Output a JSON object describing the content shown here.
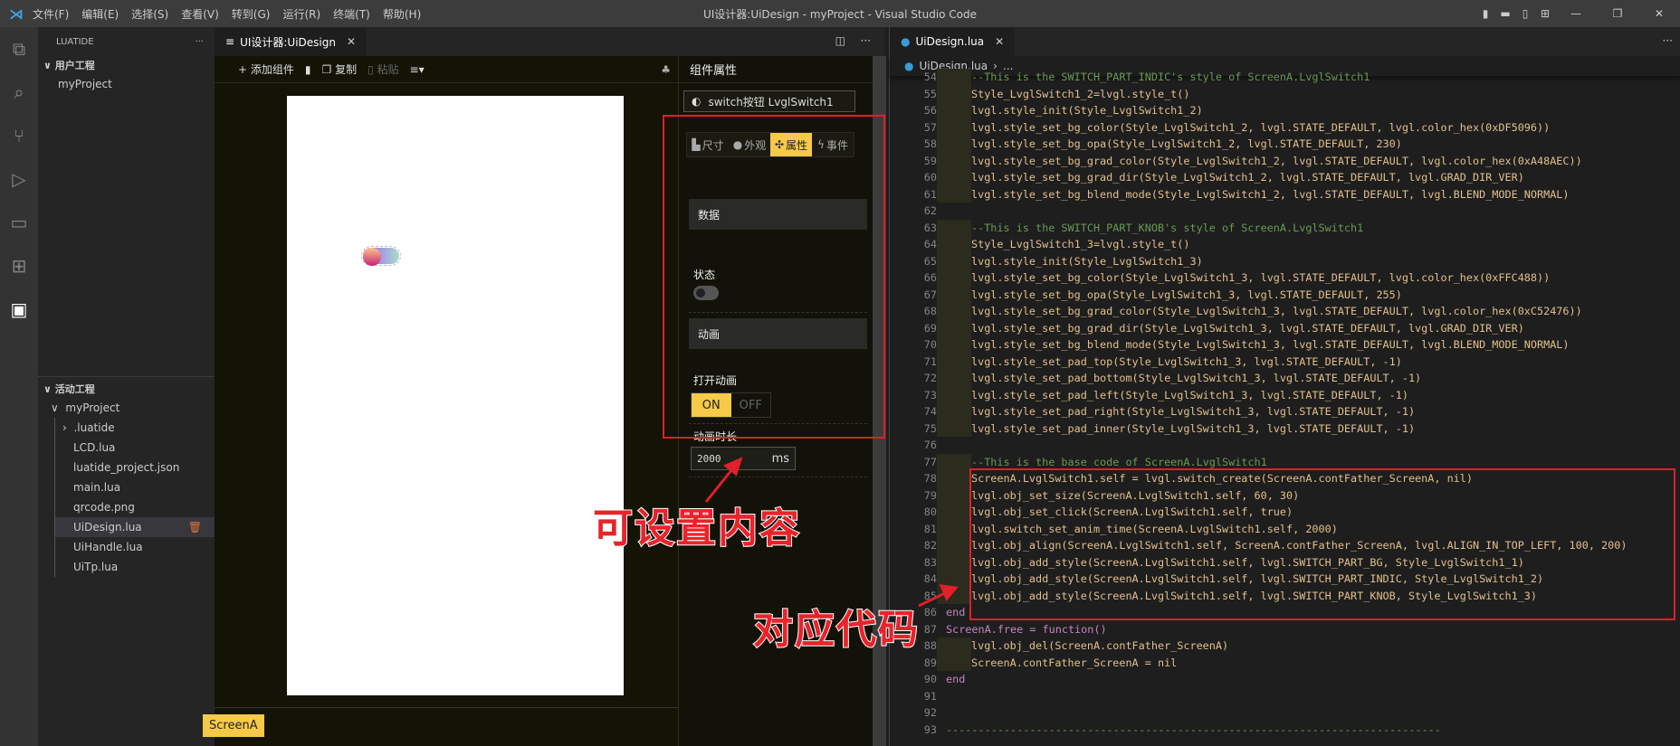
{
  "titlebar": {
    "menu": [
      "文件(F)",
      "编辑(E)",
      "选择(S)",
      "查看(V)",
      "转到(G)",
      "运行(R)",
      "终端(T)",
      "帮助(H)"
    ],
    "title": "UI设计器:UiDesign - myProject - Visual Studio Code"
  },
  "sidebar": {
    "header": "LUATIDE",
    "more": "···",
    "user_section": "用户工程",
    "user_items": [
      "myProject"
    ],
    "active_section": "活动工程",
    "project": "myProject",
    "files": [
      ".luatide",
      "LCD.lua",
      "luatide_project.json",
      "main.lua",
      "qrcode.png",
      "UiDesign.lua",
      "UiHandle.lua",
      "UiTp.lua"
    ],
    "selected_file": "UiDesign.lua"
  },
  "designer": {
    "tab": "UI设计器:UiDesign",
    "toolbar": {
      "add": "+ 添加组件",
      "copy": "复制",
      "paste": "粘贴"
    },
    "screen_tab": "ScreenA",
    "props": {
      "header": "组件属性",
      "selected": "switch按钮 LvglSwitch1",
      "tabs": [
        "尺寸",
        "外观",
        "属性",
        "事件"
      ],
      "active_tab": "属性",
      "group_data": "数据",
      "state_label": "状态",
      "state_value": false,
      "group_anim": "动画",
      "anim_open_label": "打开动画",
      "on": "ON",
      "off": "OFF",
      "anim_time_label": "动画时长",
      "anim_time": "2000",
      "anim_unit": "ms"
    }
  },
  "editor": {
    "tab": "UiDesign.lua",
    "breadcrumb": "UiDesign.lua",
    "breadcrumb_more": "...",
    "lines": [
      {
        "n": "54",
        "ind": 1,
        "text": "--This is the SWITCH_PART_INDIC's style of ScreenA.LvglSwitch1"
      },
      {
        "n": "55",
        "ind": 1,
        "text": "Style_LvglSwitch1_2=lvgl.style_t()"
      },
      {
        "n": "56",
        "ind": 1,
        "text": "lvgl.style_init(Style_LvglSwitch1_2)"
      },
      {
        "n": "57",
        "ind": 1,
        "text": "lvgl.style_set_bg_color(Style_LvglSwitch1_2, lvgl.STATE_DEFAULT, lvgl.color_hex(0xDF5096))"
      },
      {
        "n": "58",
        "ind": 1,
        "text": "lvgl.style_set_bg_opa(Style_LvglSwitch1_2, lvgl.STATE_DEFAULT, 230)"
      },
      {
        "n": "59",
        "ind": 1,
        "text": "lvgl.style_set_bg_grad_color(Style_LvglSwitch1_2, lvgl.STATE_DEFAULT, lvgl.color_hex(0xA48AEC))"
      },
      {
        "n": "60",
        "ind": 1,
        "text": "lvgl.style_set_bg_grad_dir(Style_LvglSwitch1_2, lvgl.STATE_DEFAULT, lvgl.GRAD_DIR_VER)"
      },
      {
        "n": "61",
        "ind": 1,
        "text": "lvgl.style_set_bg_blend_mode(Style_LvglSwitch1_2, lvgl.STATE_DEFAULT, lvgl.BLEND_MODE_NORMAL)"
      },
      {
        "n": "62",
        "ind": 0,
        "text": ""
      },
      {
        "n": "63",
        "ind": 1,
        "text": "--This is the SWITCH_PART_KNOB's style of ScreenA.LvglSwitch1"
      },
      {
        "n": "64",
        "ind": 1,
        "text": "Style_LvglSwitch1_3=lvgl.style_t()"
      },
      {
        "n": "65",
        "ind": 1,
        "text": "lvgl.style_init(Style_LvglSwitch1_3)"
      },
      {
        "n": "66",
        "ind": 1,
        "text": "lvgl.style_set_bg_color(Style_LvglSwitch1_3, lvgl.STATE_DEFAULT, lvgl.color_hex(0xFFC488))"
      },
      {
        "n": "67",
        "ind": 1,
        "text": "lvgl.style_set_bg_opa(Style_LvglSwitch1_3, lvgl.STATE_DEFAULT, 255)"
      },
      {
        "n": "68",
        "ind": 1,
        "text": "lvgl.style_set_bg_grad_color(Style_LvglSwitch1_3, lvgl.STATE_DEFAULT, lvgl.color_hex(0xC52476))"
      },
      {
        "n": "69",
        "ind": 1,
        "text": "lvgl.style_set_bg_grad_dir(Style_LvglSwitch1_3, lvgl.STATE_DEFAULT, lvgl.GRAD_DIR_VER)"
      },
      {
        "n": "70",
        "ind": 1,
        "text": "lvgl.style_set_bg_blend_mode(Style_LvglSwitch1_3, lvgl.STATE_DEFAULT, lvgl.BLEND_MODE_NORMAL)"
      },
      {
        "n": "71",
        "ind": 1,
        "text": "lvgl.style_set_pad_top(Style_LvglSwitch1_3, lvgl.STATE_DEFAULT, -1)"
      },
      {
        "n": "72",
        "ind": 1,
        "text": "lvgl.style_set_pad_bottom(Style_LvglSwitch1_3, lvgl.STATE_DEFAULT, -1)"
      },
      {
        "n": "73",
        "ind": 1,
        "text": "lvgl.style_set_pad_left(Style_LvglSwitch1_3, lvgl.STATE_DEFAULT, -1)"
      },
      {
        "n": "74",
        "ind": 1,
        "text": "lvgl.style_set_pad_right(Style_LvglSwitch1_3, lvgl.STATE_DEFAULT, -1)"
      },
      {
        "n": "75",
        "ind": 1,
        "text": "lvgl.style_set_pad_inner(Style_LvglSwitch1_3, lvgl.STATE_DEFAULT, -1)"
      },
      {
        "n": "76",
        "ind": 0,
        "text": ""
      },
      {
        "n": "77",
        "ind": 1,
        "text": "--This is the base code of ScreenA.LvglSwitch1"
      },
      {
        "n": "78",
        "ind": 1,
        "text": "ScreenA.LvglSwitch1.self = lvgl.switch_create(ScreenA.contFather_ScreenA, nil)"
      },
      {
        "n": "79",
        "ind": 1,
        "text": "lvgl.obj_set_size(ScreenA.LvglSwitch1.self, 60, 30)"
      },
      {
        "n": "80",
        "ind": 1,
        "text": "lvgl.obj_set_click(ScreenA.LvglSwitch1.self, true)"
      },
      {
        "n": "81",
        "ind": 1,
        "text": "lvgl.switch_set_anim_time(ScreenA.LvglSwitch1.self, 2000)"
      },
      {
        "n": "82",
        "ind": 1,
        "text": "lvgl.obj_align(ScreenA.LvglSwitch1.self, ScreenA.contFather_ScreenA, lvgl.ALIGN_IN_TOP_LEFT, 100, 200)"
      },
      {
        "n": "83",
        "ind": 1,
        "text": "lvgl.obj_add_style(ScreenA.LvglSwitch1.self, lvgl.SWITCH_PART_BG, Style_LvglSwitch1_1)"
      },
      {
        "n": "84",
        "ind": 1,
        "text": "lvgl.obj_add_style(ScreenA.LvglSwitch1.self, lvgl.SWITCH_PART_INDIC, Style_LvglSwitch1_2)"
      },
      {
        "n": "85",
        "ind": 1,
        "text": "lvgl.obj_add_style(ScreenA.LvglSwitch1.self, lvgl.SWITCH_PART_KNOB, Style_LvglSwitch1_3)"
      },
      {
        "n": "86",
        "ind": -1,
        "text": "end"
      },
      {
        "n": "87",
        "ind": -1,
        "text": "ScreenA.free = function()"
      },
      {
        "n": "88",
        "ind": 1,
        "text": "lvgl.obj_del(ScreenA.contFather_ScreenA)"
      },
      {
        "n": "89",
        "ind": 1,
        "text": "ScreenA.contFather_ScreenA = nil"
      },
      {
        "n": "90",
        "ind": -1,
        "text": "end"
      },
      {
        "n": "91",
        "ind": 0,
        "text": ""
      },
      {
        "n": "92",
        "ind": 0,
        "text": ""
      },
      {
        "n": "93",
        "ind": -1,
        "text": "-----------------------------------------------------------------------------"
      }
    ]
  },
  "annotations": {
    "settable": "可设置内容",
    "code": "对应代码",
    "color": "#e0202a"
  }
}
